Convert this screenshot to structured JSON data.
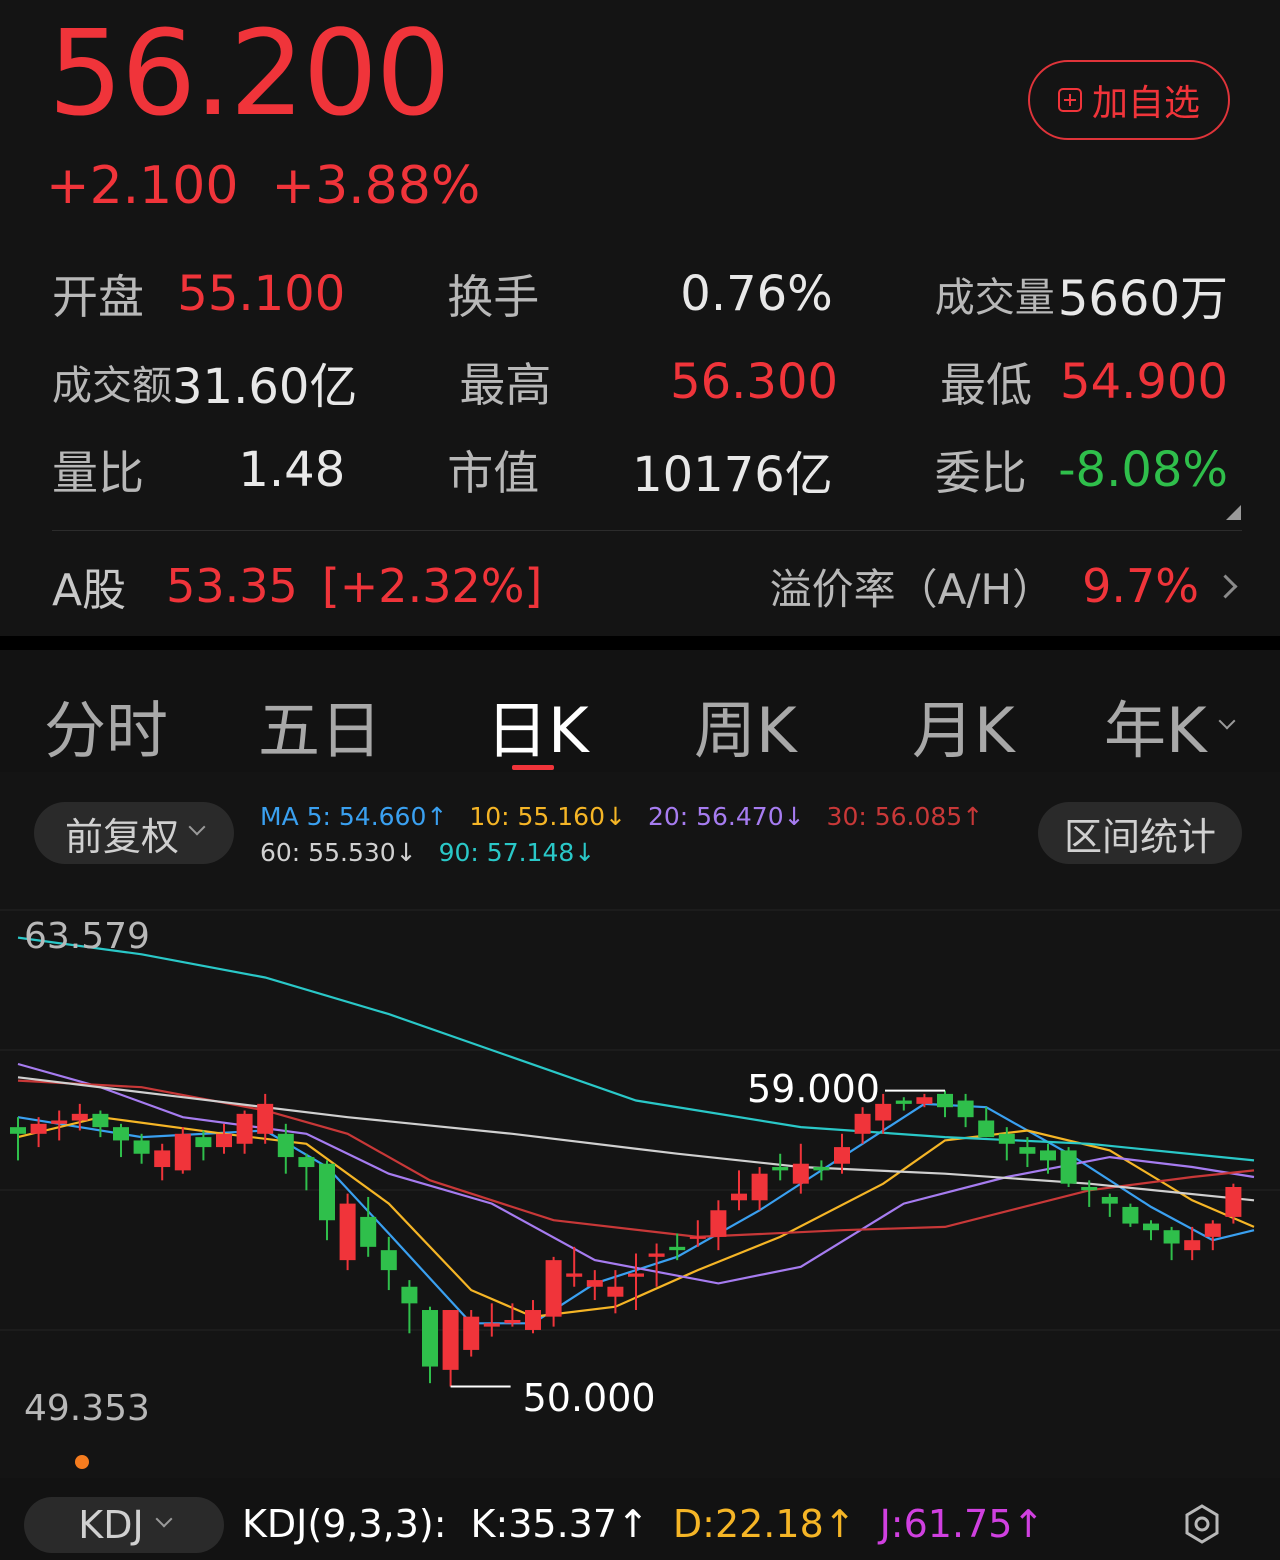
{
  "quote": {
    "price": "56.200",
    "change": "+2.100",
    "change_pct": "+3.88%",
    "add_watch_label": "加自选"
  },
  "stats": [
    [
      {
        "label": "开盘",
        "value": "55.100",
        "color": "red"
      },
      {
        "label": "换手",
        "value": "0.76%",
        "color": "white"
      },
      {
        "label": "成交量",
        "value": "5660万",
        "color": "white"
      }
    ],
    [
      {
        "label": "成交额",
        "value": "31.60亿",
        "color": "white"
      },
      {
        "label": "最高",
        "value": "56.300",
        "color": "red"
      },
      {
        "label": "最低",
        "value": "54.900",
        "color": "red"
      }
    ],
    [
      {
        "label": "量比",
        "value": "1.48",
        "color": "white"
      },
      {
        "label": "市值",
        "value": "10176亿",
        "color": "white"
      },
      {
        "label": "委比",
        "value": "-8.08%",
        "color": "green"
      }
    ]
  ],
  "a_share": {
    "label": "A股",
    "price": "53.35",
    "pct": "[+2.32%]",
    "premium_label": "溢价率（A/H）",
    "premium_value": "9.7%"
  },
  "tabs": [
    {
      "label": "分时",
      "active": false
    },
    {
      "label": "五日",
      "active": false
    },
    {
      "label": "日K",
      "active": true
    },
    {
      "label": "周K",
      "active": false
    },
    {
      "label": "月K",
      "active": false
    },
    {
      "label": "年K",
      "active": false
    }
  ],
  "chart_controls": {
    "adjust_label": "前复权",
    "range_stats_label": "区间统计",
    "indicator_label": "KDJ"
  },
  "ma_legend": [
    {
      "text": "MA 5: 54.660↑",
      "color": "#3aa0f0"
    },
    {
      "text": "10: 55.160↓",
      "color": "#f5b526"
    },
    {
      "text": "20: 56.470↓",
      "color": "#a67cf0"
    },
    {
      "text": "30: 56.085↑",
      "color": "#c83838"
    },
    {
      "text": "60: 55.530↓",
      "color": "#d0d0d0"
    },
    {
      "text": "90: 57.148↓",
      "color": "#2ac8c8"
    }
  ],
  "kdj": [
    {
      "text": "KDJ(9,3,3):",
      "color": "#ffffff"
    },
    {
      "text": "K:35.37↑",
      "color": "#ffffff"
    },
    {
      "text": "D:22.18↑",
      "color": "#f5b526"
    },
    {
      "text": "J:61.75↑",
      "color": "#d040e0"
    }
  ],
  "chart_data": {
    "type": "candlestick",
    "y_top_label": "63.579",
    "y_bottom_label": "49.353",
    "ylim": [
      49.353,
      63.579
    ],
    "high_marker": "59.000",
    "low_marker": "50.000",
    "colors": {
      "up": "#f0343a",
      "down": "#2fbf4b"
    },
    "candles": [
      [
        57.8,
        57.6,
        58.1,
        56.8
      ],
      [
        57.6,
        57.9,
        58.1,
        57.2
      ],
      [
        57.9,
        58.0,
        58.3,
        57.4
      ],
      [
        58.0,
        58.2,
        58.5,
        57.7
      ],
      [
        58.2,
        57.8,
        58.3,
        57.5
      ],
      [
        57.8,
        57.4,
        57.9,
        56.9
      ],
      [
        57.4,
        57.0,
        57.6,
        56.7
      ],
      [
        56.6,
        57.1,
        57.3,
        56.2
      ],
      [
        56.5,
        57.6,
        57.8,
        56.4
      ],
      [
        57.5,
        57.2,
        57.7,
        56.8
      ],
      [
        57.2,
        57.6,
        57.9,
        57.0
      ],
      [
        57.3,
        58.2,
        58.3,
        57.0
      ],
      [
        57.6,
        58.5,
        58.8,
        57.3
      ],
      [
        57.6,
        56.9,
        57.9,
        56.4
      ],
      [
        56.9,
        56.6,
        57.0,
        55.9
      ],
      [
        56.7,
        55.0,
        56.8,
        54.4
      ],
      [
        53.8,
        55.5,
        55.8,
        53.5
      ],
      [
        55.1,
        54.2,
        55.7,
        53.9
      ],
      [
        54.1,
        53.5,
        54.5,
        52.9
      ],
      [
        53.0,
        52.5,
        53.2,
        51.6
      ],
      [
        52.3,
        50.6,
        52.4,
        50.1
      ],
      [
        50.5,
        52.3,
        52.3,
        50.0
      ],
      [
        51.1,
        52.1,
        52.3,
        50.9
      ],
      [
        51.8,
        51.9,
        52.5,
        51.5
      ],
      [
        51.9,
        52.0,
        52.5,
        51.8
      ],
      [
        51.7,
        52.3,
        52.6,
        51.6
      ],
      [
        52.1,
        53.8,
        53.9,
        51.8
      ],
      [
        53.3,
        53.4,
        54.2,
        53.0
      ],
      [
        53.0,
        53.2,
        53.5,
        52.6
      ],
      [
        52.7,
        53.0,
        53.5,
        52.2
      ],
      [
        53.3,
        53.4,
        54.0,
        52.3
      ],
      [
        53.9,
        54.0,
        54.3,
        53.0
      ],
      [
        54.2,
        54.1,
        54.6,
        53.8
      ],
      [
        54.5,
        54.5,
        55.0,
        54.2
      ],
      [
        54.5,
        55.3,
        55.6,
        54.1
      ],
      [
        55.6,
        55.8,
        56.5,
        55.3
      ],
      [
        55.6,
        56.4,
        56.6,
        55.3
      ],
      [
        56.6,
        56.5,
        57.0,
        56.2
      ],
      [
        56.1,
        56.7,
        57.3,
        55.8
      ],
      [
        56.6,
        56.5,
        56.8,
        56.2
      ],
      [
        56.7,
        57.2,
        57.6,
        56.4
      ],
      [
        57.6,
        58.2,
        58.4,
        57.3
      ],
      [
        58.0,
        58.5,
        58.8,
        57.6
      ],
      [
        58.6,
        58.5,
        58.7,
        58.3
      ],
      [
        58.5,
        58.7,
        58.8,
        58.4
      ],
      [
        58.8,
        58.4,
        58.9,
        58.1
      ],
      [
        58.6,
        58.1,
        58.8,
        57.8
      ],
      [
        58.0,
        57.5,
        58.4,
        57.5
      ],
      [
        57.6,
        57.3,
        57.8,
        56.8
      ],
      [
        57.2,
        57.0,
        57.5,
        56.6
      ],
      [
        57.1,
        56.8,
        57.3,
        56.4
      ],
      [
        57.1,
        56.1,
        57.2,
        56.0
      ],
      [
        56.0,
        55.9,
        56.2,
        55.4
      ],
      [
        55.7,
        55.5,
        55.8,
        55.1
      ],
      [
        55.4,
        54.9,
        55.5,
        54.8
      ],
      [
        54.9,
        54.7,
        55.0,
        54.4
      ],
      [
        54.7,
        54.3,
        54.8,
        53.8
      ],
      [
        54.1,
        54.4,
        54.8,
        53.8
      ],
      [
        54.5,
        54.9,
        55.0,
        54.1
      ],
      [
        55.1,
        56.0,
        56.1,
        54.9
      ]
    ],
    "ma_series": [
      {
        "name": "MA 5",
        "color": "#3aa0f0",
        "values": [
          [
            0,
            58.1
          ],
          [
            6,
            57.5
          ],
          [
            12,
            57.7
          ],
          [
            15,
            56.6
          ],
          [
            18,
            54.6
          ],
          [
            22,
            51.9
          ],
          [
            25,
            51.9
          ],
          [
            28,
            53.1
          ],
          [
            32,
            53.9
          ],
          [
            36,
            55.3
          ],
          [
            40,
            56.9
          ],
          [
            44,
            58.5
          ],
          [
            47,
            58.4
          ],
          [
            51,
            57.0
          ],
          [
            55,
            55.4
          ],
          [
            58,
            54.4
          ],
          [
            60,
            54.7
          ]
        ]
      },
      {
        "name": "10",
        "color": "#f5b526",
        "values": [
          [
            0,
            57.5
          ],
          [
            4,
            58.1
          ],
          [
            10,
            57.6
          ],
          [
            14,
            57.3
          ],
          [
            18,
            55.5
          ],
          [
            22,
            52.9
          ],
          [
            25,
            52.1
          ],
          [
            29,
            52.4
          ],
          [
            33,
            53.5
          ],
          [
            37,
            54.5
          ],
          [
            42,
            56.1
          ],
          [
            45,
            57.4
          ],
          [
            49,
            57.7
          ],
          [
            53,
            57.1
          ],
          [
            57,
            55.6
          ],
          [
            60,
            54.8
          ]
        ]
      },
      {
        "name": "20",
        "color": "#a67cf0",
        "values": [
          [
            0,
            59.7
          ],
          [
            4,
            59.0
          ],
          [
            8,
            58.1
          ],
          [
            14,
            57.6
          ],
          [
            18,
            56.4
          ],
          [
            23,
            55.5
          ],
          [
            28,
            53.8
          ],
          [
            34,
            53.1
          ],
          [
            38,
            53.6
          ],
          [
            43,
            55.5
          ],
          [
            48,
            56.3
          ],
          [
            53,
            56.9
          ],
          [
            57,
            56.6
          ],
          [
            60,
            56.3
          ]
        ]
      },
      {
        "name": "30",
        "color": "#c83838",
        "values": [
          [
            0,
            59.2
          ],
          [
            6,
            59.0
          ],
          [
            12,
            58.3
          ],
          [
            16,
            57.6
          ],
          [
            20,
            56.2
          ],
          [
            26,
            55.0
          ],
          [
            33,
            54.5
          ],
          [
            40,
            54.7
          ],
          [
            45,
            54.8
          ],
          [
            52,
            55.9
          ],
          [
            57,
            56.3
          ],
          [
            60,
            56.5
          ]
        ]
      },
      {
        "name": "60",
        "color": "#d0d0d0",
        "values": [
          [
            0,
            59.3
          ],
          [
            8,
            58.7
          ],
          [
            16,
            58.1
          ],
          [
            24,
            57.6
          ],
          [
            32,
            57.0
          ],
          [
            38,
            56.6
          ],
          [
            45,
            56.4
          ],
          [
            52,
            56.1
          ],
          [
            60,
            55.6
          ]
        ]
      },
      {
        "name": "90",
        "color": "#2ac8c8",
        "values": [
          [
            0,
            63.5
          ],
          [
            6,
            63.0
          ],
          [
            12,
            62.3
          ],
          [
            18,
            61.2
          ],
          [
            24,
            59.9
          ],
          [
            30,
            58.6
          ],
          [
            38,
            57.8
          ],
          [
            45,
            57.5
          ],
          [
            52,
            57.3
          ],
          [
            60,
            56.8
          ]
        ]
      }
    ]
  }
}
